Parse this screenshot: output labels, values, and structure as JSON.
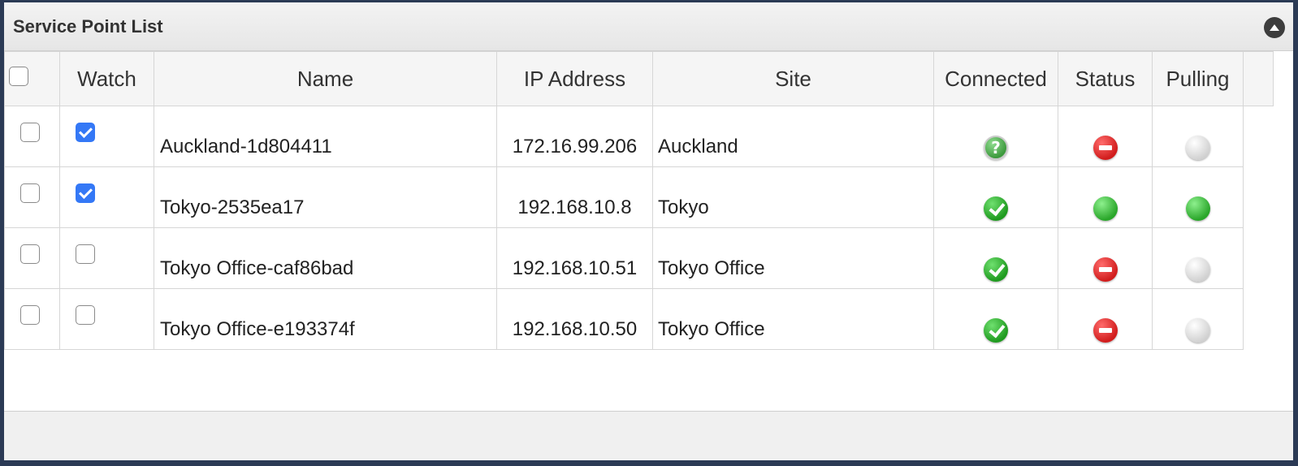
{
  "panel": {
    "title": "Service Point List"
  },
  "columns": {
    "watch": "Watch",
    "name": "Name",
    "ip": "IP Address",
    "site": "Site",
    "connected": "Connected",
    "status": "Status",
    "pulling": "Pulling"
  },
  "rows": [
    {
      "selected": false,
      "watch": true,
      "name": "Auckland-1d804411",
      "ip": "172.16.99.206",
      "site": "Auckland",
      "connected": "unknown-icon",
      "status": "stop-icon",
      "pulling": "grey-dot-icon"
    },
    {
      "selected": false,
      "watch": true,
      "name": "Tokyo-2535ea17",
      "ip": "192.168.10.8",
      "site": "Tokyo",
      "connected": "check-icon",
      "status": "green-dot-icon",
      "pulling": "green-dot-icon"
    },
    {
      "selected": false,
      "watch": false,
      "name": "Tokyo Office-caf86bad",
      "ip": "192.168.10.51",
      "site": "Tokyo Office",
      "connected": "check-icon",
      "status": "stop-icon",
      "pulling": "grey-dot-icon"
    },
    {
      "selected": false,
      "watch": false,
      "name": "Tokyo Office-e193374f",
      "ip": "192.168.10.50",
      "site": "Tokyo Office",
      "connected": "check-icon",
      "status": "stop-icon",
      "pulling": "grey-dot-icon"
    }
  ],
  "colors": {
    "frame": "#2b3a55",
    "checkbox_checked": "#3478f6",
    "ok_green": "#1f9a1f",
    "stop_red": "#d11d1d",
    "idle_grey": "#cfcfcf"
  }
}
